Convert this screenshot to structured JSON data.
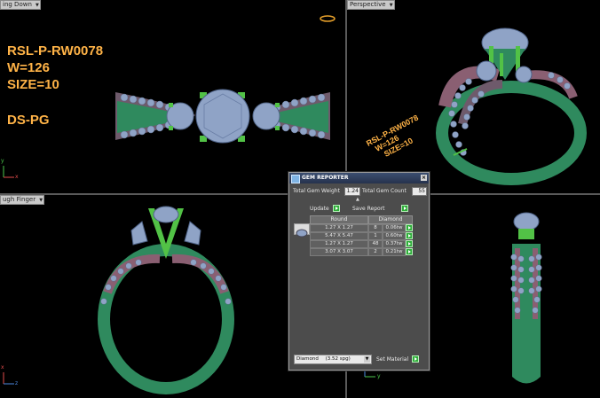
{
  "viewports": {
    "top_left": {
      "label": "ing Down"
    },
    "top_right": {
      "label": "Perspective"
    },
    "bottom_left": {
      "label": "ugh Finger"
    }
  },
  "annotations": {
    "model": "RSL-P-RW0078",
    "weight": "W=126",
    "size": "SIZE=10",
    "code": "DS-PG",
    "rotated_model": "RSL-P-RW0078",
    "rotated_weight": "W=126",
    "rotated_size": "SIZE=10"
  },
  "axes": {
    "y": "y",
    "x": "x",
    "z": "z"
  },
  "gem_reporter": {
    "title": "GEM REPORTER",
    "total_weight_label": "Total Gem Weight",
    "total_weight": "1.24",
    "total_count_label": "Total Gem Count",
    "total_count": "55",
    "update_label": "Update",
    "save_label": "Save Report",
    "columns": [
      "Round",
      "Diamond"
    ],
    "rows": [
      {
        "size": "1.27 X 1.27",
        "count": "8",
        "weight": "0.06tw"
      },
      {
        "size": "5.47 X 5.47",
        "count": "1",
        "weight": "0.60tw"
      },
      {
        "size": "1.27 X 1.27",
        "count": "48",
        "weight": "0.37tw"
      },
      {
        "size": "3.07 X 3.07",
        "count": "2",
        "weight": "0.21tw"
      }
    ],
    "material": "Diamond",
    "material_sg": "(3.52 spg)",
    "set_material_label": "Set Material"
  },
  "colors": {
    "metal_green": "#2f8a5e",
    "metal_rose": "#8a5f72",
    "gem_blue": "#8fa3c6",
    "prong_green": "#52c246",
    "annotation": "#ffb347"
  }
}
